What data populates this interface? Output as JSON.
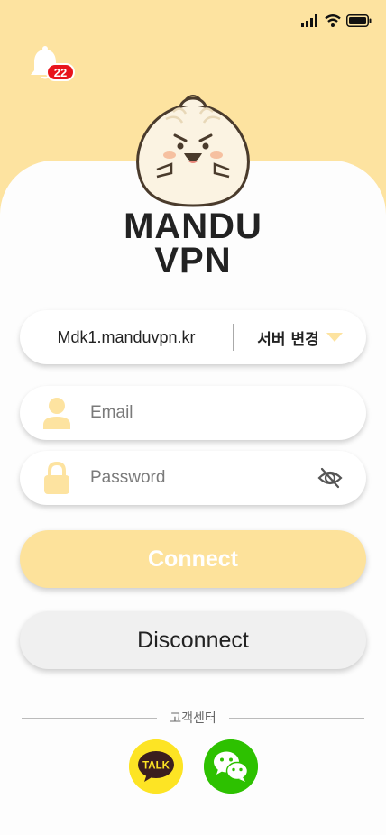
{
  "notifications": {
    "count": "22"
  },
  "brand": {
    "line1": "MANDU",
    "line2": "VPN"
  },
  "server": {
    "host": "Mdk1.manduvpn.kr",
    "change_label": "서버 변경"
  },
  "login": {
    "email_placeholder": "Email",
    "password_placeholder": "Password"
  },
  "buttons": {
    "connect": "Connect",
    "disconnect": "Disconnect"
  },
  "support": {
    "label": "고객센터"
  },
  "social": {
    "kakao_label": "TALK"
  },
  "colors": {
    "background_top": "#fde3a0",
    "sheet": "#fdfdfd",
    "connect_button": "#fde29b",
    "badge": "#e8141c",
    "kakao": "#fde424",
    "wechat": "#2dc100"
  },
  "icons": [
    "signal-icon",
    "wifi-icon",
    "battery-icon",
    "bell-icon",
    "user-icon",
    "lock-icon",
    "eye-off-icon",
    "caret-down-icon",
    "kakaotalk-icon",
    "wechat-icon"
  ]
}
